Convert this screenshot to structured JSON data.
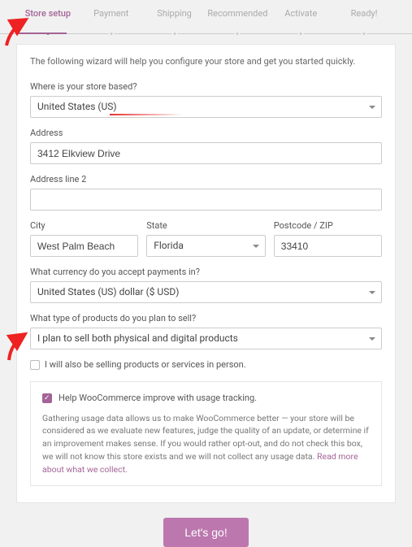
{
  "steps": {
    "items": [
      {
        "label": "Store setup",
        "active": true
      },
      {
        "label": "Payment",
        "active": false
      },
      {
        "label": "Shipping",
        "active": false
      },
      {
        "label": "Recommended",
        "active": false
      },
      {
        "label": "Activate",
        "active": false
      },
      {
        "label": "Ready!",
        "active": false
      }
    ]
  },
  "intro": "The following wizard will help you configure your store and get you started quickly.",
  "location": {
    "label": "Where is your store based?",
    "value": "United States (US)"
  },
  "address": {
    "label": "Address",
    "value": "3412 Elkview Drive"
  },
  "address2": {
    "label": "Address line 2",
    "value": ""
  },
  "city": {
    "label": "City",
    "value": "West Palm Beach"
  },
  "state": {
    "label": "State",
    "value": "Florida"
  },
  "zip": {
    "label": "Postcode / ZIP",
    "value": "33410"
  },
  "currency": {
    "label": "What currency do you accept payments in?",
    "value": "United States (US) dollar ($ USD)"
  },
  "product_type": {
    "label": "What type of products do you plan to sell?",
    "value": "I plan to sell both physical and digital products"
  },
  "in_person": {
    "checked": false,
    "label": "I will also be selling products or services in person."
  },
  "tracking": {
    "checked": true,
    "title": "Help WooCommerce improve with usage tracking.",
    "body": "Gathering usage data allows us to make WooCommerce better — your store will be considered as we evaluate new features, judge the quality of an update, or determine if an improvement makes sense. If you would rather opt-out, and do not check this box, we will not know this store exists and we will not collect any usage data. ",
    "link": "Read more about what we collect."
  },
  "cta": "Let's go!"
}
